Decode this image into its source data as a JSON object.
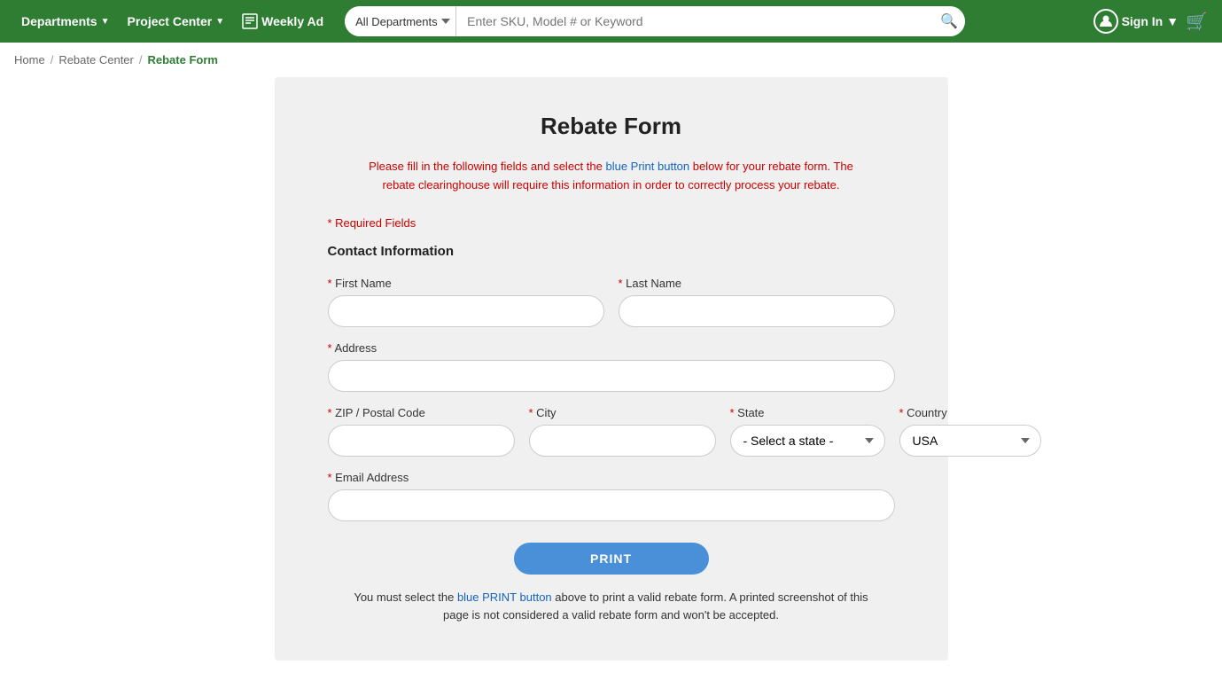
{
  "header": {
    "departments_label": "Departments",
    "project_center_label": "Project Center",
    "weekly_ad_label": "Weekly Ad",
    "search_dept_default": "All Departments",
    "search_placeholder": "Enter SKU, Model # or Keyword",
    "sign_in_label": "Sign In"
  },
  "breadcrumb": {
    "home": "Home",
    "rebate_center": "Rebate Center",
    "current": "Rebate Form"
  },
  "form": {
    "title": "Rebate Form",
    "subtitle_part1": "Please fill in the following fields and select the blue Print button below for your rebate form. The rebate clearinghouse will require this information in order to correctly process your rebate.",
    "required_note": "* Required Fields",
    "contact_section": "Contact Information",
    "first_name_label": "* First Name",
    "last_name_label": "* Last Name",
    "address_label": "* Address",
    "zip_label": "* ZIP / Postal Code",
    "city_label": "* City",
    "state_label": "* State",
    "country_label": "* Country",
    "email_label": "* Email Address",
    "state_default": "- Select a state -",
    "country_default": "USA",
    "print_btn": "PRINT",
    "bottom_note": "You must select the blue PRINT button above to print a valid rebate form. A printed screenshot of this page is not considered a valid rebate form and won't be accepted."
  }
}
